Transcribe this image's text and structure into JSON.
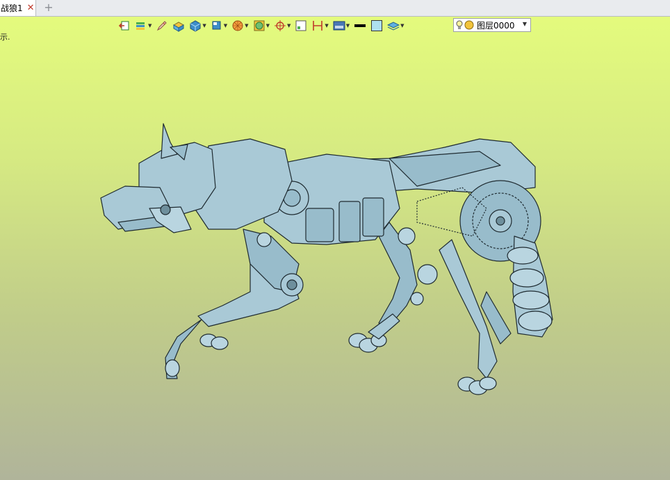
{
  "tab": {
    "title": "战狼1",
    "close_icon": "close-icon",
    "new_tab_icon": "plus-icon"
  },
  "viewport": {
    "hint_text": "示."
  },
  "toolbar": {
    "tools": [
      {
        "name": "exit-sketch-icon",
        "dropdown": false
      },
      {
        "name": "layers-tool-icon",
        "dropdown": true
      },
      {
        "name": "pencil-icon",
        "dropdown": false
      },
      {
        "name": "solid-box-icon",
        "dropdown": false
      },
      {
        "name": "cube-icon",
        "dropdown": true
      },
      {
        "name": "view-orient-icon",
        "dropdown": true
      },
      {
        "name": "render-sphere-icon",
        "dropdown": true
      },
      {
        "name": "display-mode-icon",
        "dropdown": true
      },
      {
        "name": "target-icon",
        "dropdown": true
      },
      {
        "name": "grid-icon",
        "dropdown": false
      },
      {
        "name": "dimension-icon",
        "dropdown": true
      },
      {
        "name": "background-icon",
        "dropdown": true
      },
      {
        "name": "line-color-icon",
        "dropdown": false
      },
      {
        "name": "fill-color-icon",
        "dropdown": false
      },
      {
        "name": "stack-icon",
        "dropdown": true
      }
    ],
    "layer_select": {
      "value": "图层0000",
      "bulb_icon": "bulb-icon",
      "color_icon": "layer-color-icon"
    }
  },
  "colors": {
    "model": "#a9c9d6",
    "edge": "#1e2a30",
    "viewport_top": "#e4fb7d",
    "viewport_bottom": "#b0b49a"
  }
}
